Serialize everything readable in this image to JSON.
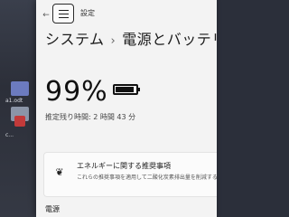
{
  "desktop": {
    "icons": [
      {
        "label": "a1.odt",
        "color": "#6c7bbf"
      },
      {
        "label": "",
        "color": "#8b95a8"
      },
      {
        "label": "",
        "color": "#c23a3a"
      },
      {
        "label": "c...",
        "color": "#7a8195"
      }
    ]
  },
  "window": {
    "app_title": "設定",
    "back_icon": "←",
    "breadcrumb_parent": "システム",
    "breadcrumb_separator": "›",
    "breadcrumb_current": "電源とバッテリー"
  },
  "battery": {
    "percent_label": "99%",
    "level": 0.99,
    "time_remaining": "推定残り時間: 2 時間 43 分"
  },
  "recommendation": {
    "title": "エネルギーに関する推奨事項",
    "description": "これらの推奨事項を適用して二酸化炭素排出量を削減する"
  },
  "sections": {
    "power_label": "電源"
  }
}
